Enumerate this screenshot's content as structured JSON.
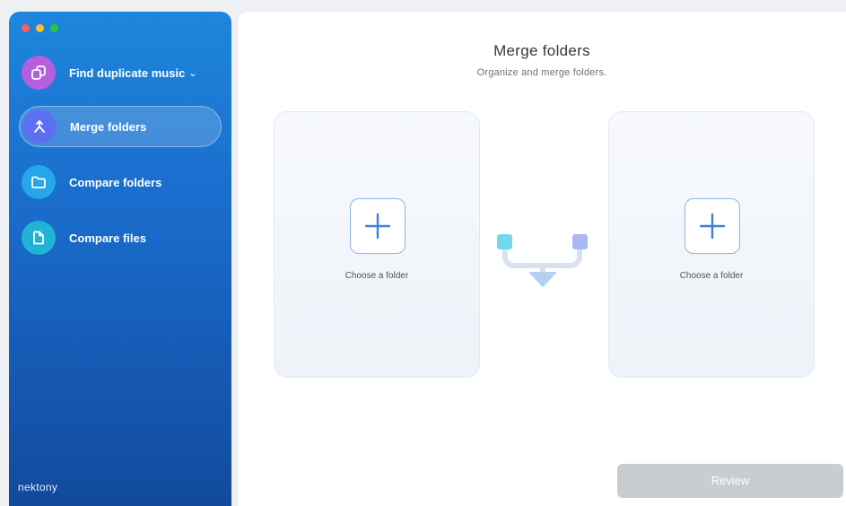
{
  "window": {
    "traffic_lights": {
      "close": "#fe5f57",
      "minimize": "#febc2e",
      "zoom": "#28c840"
    }
  },
  "sidebar": {
    "items": [
      {
        "label": "Find duplicate music",
        "icon": "duplicate-icon",
        "icon_color": "#b65ee0",
        "has_dropdown": true,
        "active": false
      },
      {
        "label": "Merge folders",
        "icon": "merge-icon",
        "icon_color": "#5c6ff0",
        "active": true
      },
      {
        "label": "Compare folders",
        "icon": "folder-icon",
        "icon_color": "#27a7ea",
        "active": false
      },
      {
        "label": "Compare files",
        "icon": "file-icon",
        "icon_color": "#1fb3d6",
        "active": false
      }
    ],
    "brand": "nektony"
  },
  "main": {
    "title": "Merge folders",
    "subtitle": "Organize and merge folders.",
    "left_card": {
      "label": "Choose a folder",
      "icon": "plus-icon"
    },
    "right_card": {
      "label": "Choose a folder",
      "icon": "plus-icon"
    },
    "review_button": "Review"
  },
  "colors": {
    "sidebar_gradient_top": "#1e86dc",
    "sidebar_gradient_bottom": "#124a9a",
    "accent_blue": "#3b82d8",
    "merge_left_node": "#74d7f2",
    "merge_right_node": "#a7b8f5",
    "review_disabled": "#c9ccd0"
  }
}
